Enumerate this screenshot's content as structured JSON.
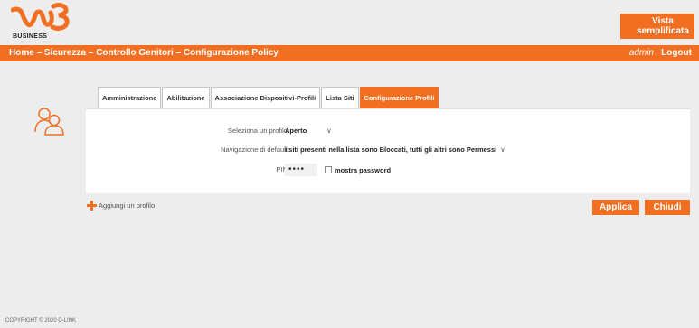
{
  "header": {
    "logo_text": "BUSINESS",
    "vista_button": "Vista semplificata"
  },
  "navbar": {
    "breadcrumb": [
      "Home",
      "Sicurezza",
      "Controllo Genitori",
      "Configurazione Policy"
    ],
    "separator": " – ",
    "user": "admin",
    "logout": "Logout"
  },
  "tabs": [
    {
      "label": "Amministrazione",
      "active": false
    },
    {
      "label": "Abilitazione",
      "active": false
    },
    {
      "label": "Associazione Dispositivi-Profili",
      "active": false
    },
    {
      "label": "Lista Siti",
      "active": false
    },
    {
      "label": "Configurazione Profili",
      "active": true
    }
  ],
  "form": {
    "profile_label": "Seleziona un profilo:",
    "profile_value": "Aperto",
    "default_nav_label": "Navigazione di default:",
    "default_nav_value": "i siti presenti nella lista sono Bloccati, tutti gli altri sono Permessi",
    "pin_label": "PIN:",
    "pin_value": "••••",
    "show_password_label": "mostra password"
  },
  "actions": {
    "add_profile": "Aggiungi un profilo",
    "apply": "Applica",
    "close": "Chiudi"
  },
  "footer": {
    "copyright": "COPYRIGHT © 2020 D-LINK"
  },
  "colors": {
    "accent": "#f26f21",
    "background": "#ededed"
  }
}
